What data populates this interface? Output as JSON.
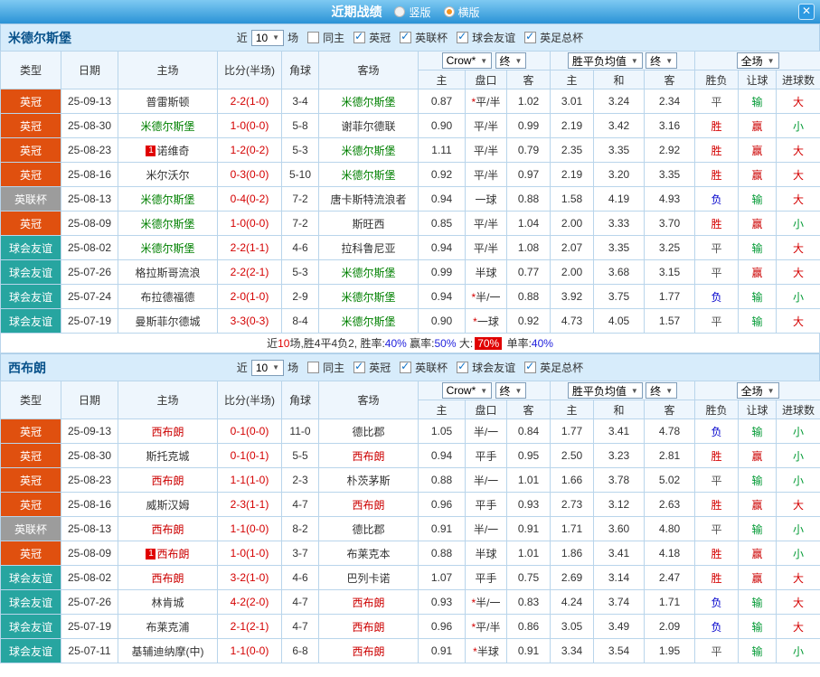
{
  "colors": {
    "accent_blue": "#2a93d6",
    "league_championship": "#e0500f",
    "league_cup_gray": "#9c9c9c",
    "club_friendly_teal": "#27a5a0",
    "subject_home_red": "#cc0000",
    "subject_away_green": "#008000",
    "score_red": "#d40000"
  },
  "titlebar": {
    "title": "近期战绩",
    "vertical_label": "竖版",
    "vertical_selected": false,
    "horizontal_label": "横版",
    "horizontal_selected": true,
    "close_icon": "✕"
  },
  "filter": {
    "near": "近",
    "count": "10",
    "games": "场",
    "same_home": "同主",
    "same_home_checked": false,
    "league1": "英冠",
    "league1_checked": true,
    "league2": "英联杯",
    "league2_checked": true,
    "league3": "球会友谊",
    "league3_checked": true,
    "league4": "英足总杯",
    "league4_checked": true
  },
  "header": {
    "type": "类型",
    "date": "日期",
    "home": "主场",
    "score": "比分(半场)",
    "corner": "角球",
    "away": "客场",
    "company": "Crow*",
    "final": "终",
    "avg": "胜平负均值",
    "final2": "终",
    "full": "全场",
    "h_home": "主",
    "h_handicap": "盘口",
    "h_away": "客",
    "e_home": "主",
    "e_draw": "和",
    "e_away": "客",
    "r_result": "胜负",
    "r_handicap": "让球",
    "r_goals": "进球数"
  },
  "sections": [
    {
      "team": "米德尔斯堡",
      "rows": [
        {
          "type": "英冠",
          "tc": "lg-red",
          "date": "25-09-13",
          "home": "普雷斯顿",
          "hc": "t-dark",
          "score": "2-2(1-0)",
          "corner": "3-4",
          "away": "米德尔斯堡",
          "ac": "t-green",
          "o1": "0.87",
          "star": "*",
          "pk": "平/半",
          "o2": "1.02",
          "e1": "3.01",
          "e2": "3.24",
          "e3": "2.34",
          "r": "平",
          "rc": "r-draw",
          "hr": "输",
          "hrc": "h-lose",
          "g": "大",
          "gc": "g-big"
        },
        {
          "type": "英冠",
          "tc": "lg-red",
          "date": "25-08-30",
          "home": "米德尔斯堡",
          "hc": "t-green",
          "score": "1-0(0-0)",
          "corner": "5-8",
          "away": "谢菲尔德联",
          "ac": "t-dark",
          "o1": "0.90",
          "pk": "平/半",
          "o2": "0.99",
          "e1": "2.19",
          "e2": "3.42",
          "e3": "3.16",
          "r": "胜",
          "rc": "r-win",
          "hr": "赢",
          "hrc": "h-win",
          "g": "小",
          "gc": "g-small"
        },
        {
          "type": "英冠",
          "tc": "lg-red",
          "date": "25-08-23",
          "hbadge": "1",
          "home": "诺维奇",
          "hc": "t-dark",
          "score": "1-2(0-2)",
          "corner": "5-3",
          "away": "米德尔斯堡",
          "ac": "t-green",
          "o1": "1.11",
          "pk": "平/半",
          "o2": "0.79",
          "e1": "2.35",
          "e2": "3.35",
          "e3": "2.92",
          "r": "胜",
          "rc": "r-win",
          "hr": "赢",
          "hrc": "h-win",
          "g": "大",
          "gc": "g-big"
        },
        {
          "type": "英冠",
          "tc": "lg-red",
          "date": "25-08-16",
          "home": "米尔沃尔",
          "hc": "t-dark",
          "score": "0-3(0-0)",
          "corner": "5-10",
          "away": "米德尔斯堡",
          "ac": "t-green",
          "o1": "0.92",
          "pk": "平/半",
          "o2": "0.97",
          "e1": "2.19",
          "e2": "3.20",
          "e3": "3.35",
          "r": "胜",
          "rc": "r-win",
          "hr": "赢",
          "hrc": "h-win",
          "g": "大",
          "gc": "g-big"
        },
        {
          "type": "英联杯",
          "tc": "lg-gray",
          "date": "25-08-13",
          "home": "米德尔斯堡",
          "hc": "t-green",
          "score": "0-4(0-2)",
          "corner": "7-2",
          "away": "唐卡斯特流浪者",
          "ac": "t-dark",
          "o1": "0.94",
          "pk": "一球",
          "o2": "0.88",
          "e1": "1.58",
          "e2": "4.19",
          "e3": "4.93",
          "r": "负",
          "rc": "r-lose",
          "hr": "输",
          "hrc": "h-lose",
          "g": "大",
          "gc": "g-big"
        },
        {
          "type": "英冠",
          "tc": "lg-red",
          "date": "25-08-09",
          "home": "米德尔斯堡",
          "hc": "t-green",
          "score": "1-0(0-0)",
          "corner": "7-2",
          "away": "斯旺西",
          "ac": "t-dark",
          "o1": "0.85",
          "pk": "平/半",
          "o2": "1.04",
          "e1": "2.00",
          "e2": "3.33",
          "e3": "3.70",
          "r": "胜",
          "rc": "r-win",
          "hr": "赢",
          "hrc": "h-win",
          "g": "小",
          "gc": "g-small"
        },
        {
          "type": "球会友谊",
          "tc": "lg-teal",
          "date": "25-08-02",
          "home": "米德尔斯堡",
          "hc": "t-green",
          "score": "2-2(1-1)",
          "corner": "4-6",
          "away": "拉科鲁尼亚",
          "ac": "t-dark",
          "o1": "0.94",
          "pk": "平/半",
          "o2": "1.08",
          "e1": "2.07",
          "e2": "3.35",
          "e3": "3.25",
          "r": "平",
          "rc": "r-draw",
          "hr": "输",
          "hrc": "h-lose",
          "g": "大",
          "gc": "g-big"
        },
        {
          "type": "球会友谊",
          "tc": "lg-teal",
          "date": "25-07-26",
          "home": "格拉斯哥流浪",
          "hc": "t-dark",
          "score": "2-2(2-1)",
          "corner": "5-3",
          "away": "米德尔斯堡",
          "ac": "t-green",
          "o1": "0.99",
          "pk": "半球",
          "o2": "0.77",
          "e1": "2.00",
          "e2": "3.68",
          "e3": "3.15",
          "r": "平",
          "rc": "r-draw",
          "hr": "赢",
          "hrc": "h-win",
          "g": "大",
          "gc": "g-big"
        },
        {
          "type": "球会友谊",
          "tc": "lg-teal",
          "date": "25-07-24",
          "home": "布拉德福德",
          "hc": "t-dark",
          "score": "2-0(1-0)",
          "corner": "2-9",
          "away": "米德尔斯堡",
          "ac": "t-green",
          "o1": "0.94",
          "star": "*",
          "pk": "半/一",
          "o2": "0.88",
          "e1": "3.92",
          "e2": "3.75",
          "e3": "1.77",
          "r": "负",
          "rc": "r-lose",
          "hr": "输",
          "hrc": "h-lose",
          "g": "小",
          "gc": "g-small"
        },
        {
          "type": "球会友谊",
          "tc": "lg-teal",
          "date": "25-07-19",
          "home": "曼斯菲尔德城",
          "hc": "t-dark",
          "score": "3-3(0-3)",
          "corner": "8-4",
          "away": "米德尔斯堡",
          "ac": "t-green",
          "o1": "0.90",
          "star": "*",
          "pk": "一球",
          "o2": "0.92",
          "e1": "4.73",
          "e2": "4.05",
          "e3": "1.57",
          "r": "平",
          "rc": "r-draw",
          "hr": "输",
          "hrc": "h-lose",
          "g": "大",
          "gc": "g-big"
        }
      ],
      "summary": {
        "t1": "近",
        "count": "10",
        "t2": "场,胜4平4负2, 胜率:",
        "win": "40%",
        "t3": " 赢率:",
        "cover": "50%",
        "t4": " 大:",
        "big": "70%",
        "t5": " 单率:",
        "single": "40%"
      }
    },
    {
      "team": "西布朗",
      "rows": [
        {
          "type": "英冠",
          "tc": "lg-red",
          "date": "25-09-13",
          "home": "西布朗",
          "hc": "t-red",
          "score": "0-1(0-0)",
          "corner": "11-0",
          "away": "德比郡",
          "ac": "t-dark",
          "o1": "1.05",
          "pk": "半/一",
          "o2": "0.84",
          "e1": "1.77",
          "e2": "3.41",
          "e3": "4.78",
          "r": "负",
          "rc": "r-lose",
          "hr": "输",
          "hrc": "h-lose",
          "g": "小",
          "gc": "g-small"
        },
        {
          "type": "英冠",
          "tc": "lg-red",
          "date": "25-08-30",
          "home": "斯托克城",
          "hc": "t-dark",
          "score": "0-1(0-1)",
          "corner": "5-5",
          "away": "西布朗",
          "ac": "t-red",
          "o1": "0.94",
          "pk": "平手",
          "o2": "0.95",
          "e1": "2.50",
          "e2": "3.23",
          "e3": "2.81",
          "r": "胜",
          "rc": "r-win",
          "hr": "赢",
          "hrc": "h-win",
          "g": "小",
          "gc": "g-small"
        },
        {
          "type": "英冠",
          "tc": "lg-red",
          "date": "25-08-23",
          "home": "西布朗",
          "hc": "t-red",
          "score": "1-1(1-0)",
          "corner": "2-3",
          "away": "朴茨茅斯",
          "ac": "t-dark",
          "o1": "0.88",
          "pk": "半/一",
          "o2": "1.01",
          "e1": "1.66",
          "e2": "3.78",
          "e3": "5.02",
          "r": "平",
          "rc": "r-draw",
          "hr": "输",
          "hrc": "h-lose",
          "g": "小",
          "gc": "g-small"
        },
        {
          "type": "英冠",
          "tc": "lg-red",
          "date": "25-08-16",
          "home": "威斯汉姆",
          "hc": "t-dark",
          "score": "2-3(1-1)",
          "corner": "4-7",
          "away": "西布朗",
          "ac": "t-red",
          "o1": "0.96",
          "pk": "平手",
          "o2": "0.93",
          "e1": "2.73",
          "e2": "3.12",
          "e3": "2.63",
          "r": "胜",
          "rc": "r-win",
          "hr": "赢",
          "hrc": "h-win",
          "g": "大",
          "gc": "g-big"
        },
        {
          "type": "英联杯",
          "tc": "lg-gray",
          "date": "25-08-13",
          "home": "西布朗",
          "hc": "t-red",
          "score": "1-1(0-0)",
          "corner": "8-2",
          "away": "德比郡",
          "ac": "t-dark",
          "o1": "0.91",
          "pk": "半/一",
          "o2": "0.91",
          "e1": "1.71",
          "e2": "3.60",
          "e3": "4.80",
          "r": "平",
          "rc": "r-draw",
          "hr": "输",
          "hrc": "h-lose",
          "g": "小",
          "gc": "g-small"
        },
        {
          "type": "英冠",
          "tc": "lg-red",
          "date": "25-08-09",
          "hbadge": "1",
          "home": "西布朗",
          "hc": "t-red",
          "score": "1-0(1-0)",
          "corner": "3-7",
          "away": "布莱克本",
          "ac": "t-dark",
          "o1": "0.88",
          "pk": "半球",
          "o2": "1.01",
          "e1": "1.86",
          "e2": "3.41",
          "e3": "4.18",
          "r": "胜",
          "rc": "r-win",
          "hr": "赢",
          "hrc": "h-win",
          "g": "小",
          "gc": "g-small"
        },
        {
          "type": "球会友谊",
          "tc": "lg-teal",
          "date": "25-08-02",
          "home": "西布朗",
          "hc": "t-red",
          "score": "3-2(1-0)",
          "corner": "4-6",
          "away": "巴列卡诺",
          "ac": "t-dark",
          "o1": "1.07",
          "pk": "平手",
          "o2": "0.75",
          "e1": "2.69",
          "e2": "3.14",
          "e3": "2.47",
          "r": "胜",
          "rc": "r-win",
          "hr": "赢",
          "hrc": "h-win",
          "g": "大",
          "gc": "g-big"
        },
        {
          "type": "球会友谊",
          "tc": "lg-teal",
          "date": "25-07-26",
          "home": "林肯城",
          "hc": "t-dark",
          "score": "4-2(2-0)",
          "corner": "4-7",
          "away": "西布朗",
          "ac": "t-red",
          "o1": "0.93",
          "star": "*",
          "pk": "半/一",
          "o2": "0.83",
          "e1": "4.24",
          "e2": "3.74",
          "e3": "1.71",
          "r": "负",
          "rc": "r-lose",
          "hr": "输",
          "hrc": "h-lose",
          "g": "大",
          "gc": "g-big"
        },
        {
          "type": "球会友谊",
          "tc": "lg-teal",
          "date": "25-07-19",
          "home": "布莱克浦",
          "hc": "t-dark",
          "score": "2-1(2-1)",
          "corner": "4-7",
          "away": "西布朗",
          "ac": "t-red",
          "o1": "0.96",
          "star": "*",
          "pk": "平/半",
          "o2": "0.86",
          "e1": "3.05",
          "e2": "3.49",
          "e3": "2.09",
          "r": "负",
          "rc": "r-lose",
          "hr": "输",
          "hrc": "h-lose",
          "g": "大",
          "gc": "g-big"
        },
        {
          "type": "球会友谊",
          "tc": "lg-teal",
          "date": "25-07-11",
          "home": "基辅迪纳摩(中)",
          "hc": "t-dark",
          "score": "1-1(0-0)",
          "corner": "6-8",
          "away": "西布朗",
          "ac": "t-red",
          "o1": "0.91",
          "star": "*",
          "pk": "半球",
          "o2": "0.91",
          "e1": "3.34",
          "e2": "3.54",
          "e3": "1.95",
          "r": "平",
          "rc": "r-draw",
          "hr": "输",
          "hrc": "h-lose",
          "g": "小",
          "gc": "g-small"
        }
      ]
    }
  ]
}
